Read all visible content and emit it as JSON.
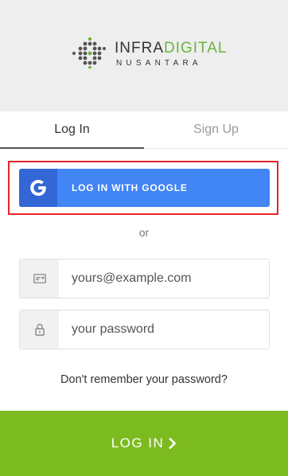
{
  "brand": {
    "name_part1": "INFRA",
    "name_part2": "DIGITAL",
    "tagline": "NUSANTARA",
    "logo_icon": "dots-diamond-logo",
    "accent_color": "#6cb33e"
  },
  "tabs": [
    {
      "label": "Log In",
      "active": true
    },
    {
      "label": "Sign Up",
      "active": false
    }
  ],
  "google_button": {
    "label": "LOG IN WITH GOOGLE",
    "icon": "google-icon",
    "color": "#4285f4"
  },
  "separator": "or",
  "email_field": {
    "placeholder": "yours@example.com",
    "value": "",
    "icon": "envelope-icon"
  },
  "password_field": {
    "placeholder": "your password",
    "value": "",
    "icon": "lock-icon"
  },
  "forgot_link": "Don't remember your password?",
  "submit_button": {
    "label": "LOG IN",
    "icon": "chevron-right-icon",
    "color": "#7cbb1f"
  },
  "highlight_color": "#e52429"
}
